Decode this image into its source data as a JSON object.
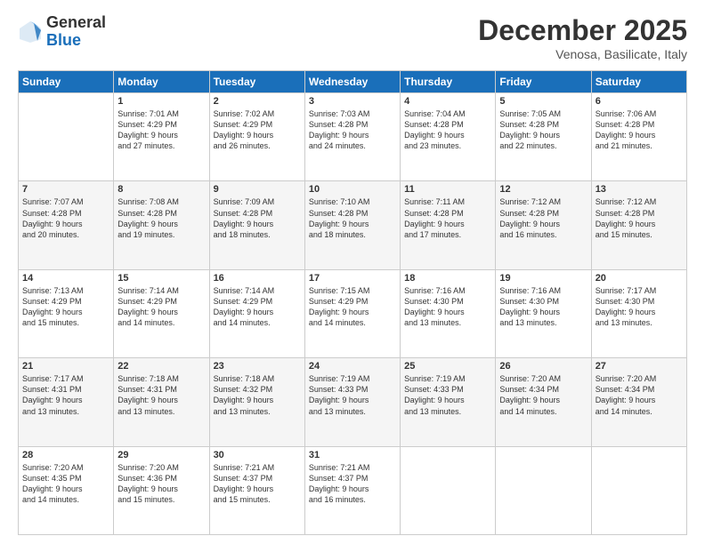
{
  "logo": {
    "general": "General",
    "blue": "Blue"
  },
  "header": {
    "month": "December 2025",
    "location": "Venosa, Basilicate, Italy"
  },
  "days": [
    "Sunday",
    "Monday",
    "Tuesday",
    "Wednesday",
    "Thursday",
    "Friday",
    "Saturday"
  ],
  "weeks": [
    [
      {
        "day": "",
        "content": ""
      },
      {
        "day": "1",
        "content": "Sunrise: 7:01 AM\nSunset: 4:29 PM\nDaylight: 9 hours\nand 27 minutes."
      },
      {
        "day": "2",
        "content": "Sunrise: 7:02 AM\nSunset: 4:29 PM\nDaylight: 9 hours\nand 26 minutes."
      },
      {
        "day": "3",
        "content": "Sunrise: 7:03 AM\nSunset: 4:28 PM\nDaylight: 9 hours\nand 24 minutes."
      },
      {
        "day": "4",
        "content": "Sunrise: 7:04 AM\nSunset: 4:28 PM\nDaylight: 9 hours\nand 23 minutes."
      },
      {
        "day": "5",
        "content": "Sunrise: 7:05 AM\nSunset: 4:28 PM\nDaylight: 9 hours\nand 22 minutes."
      },
      {
        "day": "6",
        "content": "Sunrise: 7:06 AM\nSunset: 4:28 PM\nDaylight: 9 hours\nand 21 minutes."
      }
    ],
    [
      {
        "day": "7",
        "content": "Sunrise: 7:07 AM\nSunset: 4:28 PM\nDaylight: 9 hours\nand 20 minutes."
      },
      {
        "day": "8",
        "content": "Sunrise: 7:08 AM\nSunset: 4:28 PM\nDaylight: 9 hours\nand 19 minutes."
      },
      {
        "day": "9",
        "content": "Sunrise: 7:09 AM\nSunset: 4:28 PM\nDaylight: 9 hours\nand 18 minutes."
      },
      {
        "day": "10",
        "content": "Sunrise: 7:10 AM\nSunset: 4:28 PM\nDaylight: 9 hours\nand 18 minutes."
      },
      {
        "day": "11",
        "content": "Sunrise: 7:11 AM\nSunset: 4:28 PM\nDaylight: 9 hours\nand 17 minutes."
      },
      {
        "day": "12",
        "content": "Sunrise: 7:12 AM\nSunset: 4:28 PM\nDaylight: 9 hours\nand 16 minutes."
      },
      {
        "day": "13",
        "content": "Sunrise: 7:12 AM\nSunset: 4:28 PM\nDaylight: 9 hours\nand 15 minutes."
      }
    ],
    [
      {
        "day": "14",
        "content": "Sunrise: 7:13 AM\nSunset: 4:29 PM\nDaylight: 9 hours\nand 15 minutes."
      },
      {
        "day": "15",
        "content": "Sunrise: 7:14 AM\nSunset: 4:29 PM\nDaylight: 9 hours\nand 14 minutes."
      },
      {
        "day": "16",
        "content": "Sunrise: 7:14 AM\nSunset: 4:29 PM\nDaylight: 9 hours\nand 14 minutes."
      },
      {
        "day": "17",
        "content": "Sunrise: 7:15 AM\nSunset: 4:29 PM\nDaylight: 9 hours\nand 14 minutes."
      },
      {
        "day": "18",
        "content": "Sunrise: 7:16 AM\nSunset: 4:30 PM\nDaylight: 9 hours\nand 13 minutes."
      },
      {
        "day": "19",
        "content": "Sunrise: 7:16 AM\nSunset: 4:30 PM\nDaylight: 9 hours\nand 13 minutes."
      },
      {
        "day": "20",
        "content": "Sunrise: 7:17 AM\nSunset: 4:30 PM\nDaylight: 9 hours\nand 13 minutes."
      }
    ],
    [
      {
        "day": "21",
        "content": "Sunrise: 7:17 AM\nSunset: 4:31 PM\nDaylight: 9 hours\nand 13 minutes."
      },
      {
        "day": "22",
        "content": "Sunrise: 7:18 AM\nSunset: 4:31 PM\nDaylight: 9 hours\nand 13 minutes."
      },
      {
        "day": "23",
        "content": "Sunrise: 7:18 AM\nSunset: 4:32 PM\nDaylight: 9 hours\nand 13 minutes."
      },
      {
        "day": "24",
        "content": "Sunrise: 7:19 AM\nSunset: 4:33 PM\nDaylight: 9 hours\nand 13 minutes."
      },
      {
        "day": "25",
        "content": "Sunrise: 7:19 AM\nSunset: 4:33 PM\nDaylight: 9 hours\nand 13 minutes."
      },
      {
        "day": "26",
        "content": "Sunrise: 7:20 AM\nSunset: 4:34 PM\nDaylight: 9 hours\nand 14 minutes."
      },
      {
        "day": "27",
        "content": "Sunrise: 7:20 AM\nSunset: 4:34 PM\nDaylight: 9 hours\nand 14 minutes."
      }
    ],
    [
      {
        "day": "28",
        "content": "Sunrise: 7:20 AM\nSunset: 4:35 PM\nDaylight: 9 hours\nand 14 minutes."
      },
      {
        "day": "29",
        "content": "Sunrise: 7:20 AM\nSunset: 4:36 PM\nDaylight: 9 hours\nand 15 minutes."
      },
      {
        "day": "30",
        "content": "Sunrise: 7:21 AM\nSunset: 4:37 PM\nDaylight: 9 hours\nand 15 minutes."
      },
      {
        "day": "31",
        "content": "Sunrise: 7:21 AM\nSunset: 4:37 PM\nDaylight: 9 hours\nand 16 minutes."
      },
      {
        "day": "",
        "content": ""
      },
      {
        "day": "",
        "content": ""
      },
      {
        "day": "",
        "content": ""
      }
    ]
  ]
}
